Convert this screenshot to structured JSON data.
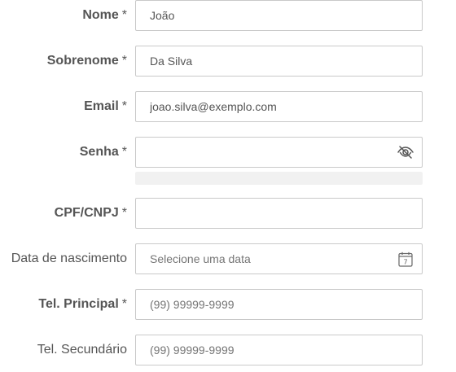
{
  "required_marker": "*",
  "fields": {
    "nome": {
      "label": "Nome",
      "value": "João",
      "placeholder": ""
    },
    "sobrenome": {
      "label": "Sobrenome",
      "value": "Da Silva",
      "placeholder": ""
    },
    "email": {
      "label": "Email",
      "value": "joao.silva@exemplo.com",
      "placeholder": ""
    },
    "senha": {
      "label": "Senha",
      "value": "",
      "placeholder": "",
      "icon": "eye-slash-icon",
      "strength": 0
    },
    "cpf": {
      "label": "CPF/CNPJ",
      "value": "",
      "placeholder": ""
    },
    "nascimento": {
      "label": "Data de nascimento",
      "value": "",
      "placeholder": "Selecione uma data",
      "icon": "calendar-icon",
      "icon_text": "7"
    },
    "tel_principal": {
      "label": "Tel. Principal",
      "value": "",
      "placeholder": "(99) 99999-9999"
    },
    "tel_secundario": {
      "label": "Tel. Secundário",
      "value": "",
      "placeholder": "(99) 99999-9999"
    }
  }
}
